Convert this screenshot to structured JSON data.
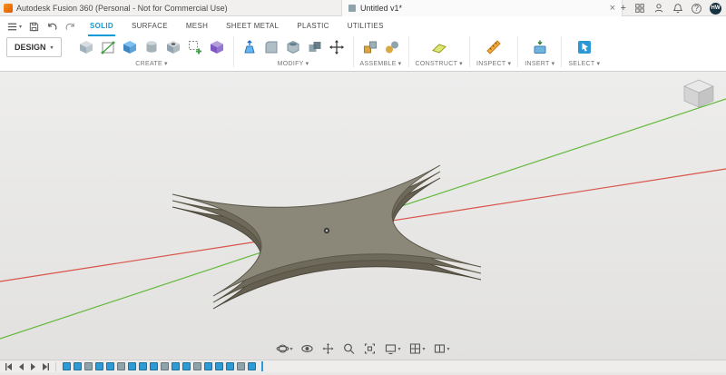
{
  "title_bar": {
    "app_title": "Autodesk Fusion 360 (Personal - Not for Commercial Use)",
    "tab_label": "Untitled v1*",
    "tab_close": "×",
    "new_tab": "+",
    "help": "?",
    "avatar": "HW",
    "right_icons": [
      "new-tab",
      "apps-grid",
      "account",
      "notifications-bell",
      "help",
      "user-avatar"
    ]
  },
  "quick_access": {
    "items": [
      "file-menu",
      "save",
      "undo",
      "redo"
    ],
    "file_menu_caret": "▾"
  },
  "workspace": {
    "label": "DESIGN",
    "caret": "▾"
  },
  "ribbon_tabs": [
    {
      "label": "SOLID",
      "active": true
    },
    {
      "label": "SURFACE",
      "active": false
    },
    {
      "label": "MESH",
      "active": false
    },
    {
      "label": "SHEET METAL",
      "active": false
    },
    {
      "label": "PLASTIC",
      "active": false
    },
    {
      "label": "UTILITIES",
      "active": false
    }
  ],
  "groups": [
    {
      "label": "CREATE",
      "caret": "▾",
      "tools": [
        "new-component",
        "create-sketch",
        "extrude",
        "revolve",
        "hole",
        "pattern",
        "derive"
      ]
    },
    {
      "label": "MODIFY",
      "caret": "▾",
      "tools": [
        "press-pull",
        "fillet",
        "shell",
        "combine",
        "move-copy"
      ]
    },
    {
      "label": "ASSEMBLE",
      "caret": "▾",
      "tools": [
        "insert-component",
        "joint"
      ]
    },
    {
      "label": "CONSTRUCT",
      "caret": "▾",
      "tools": [
        "construction-plane"
      ]
    },
    {
      "label": "INSPECT",
      "caret": "▾",
      "tools": [
        "measure"
      ]
    },
    {
      "label": "INSERT",
      "caret": "▾",
      "tools": [
        "insert"
      ]
    },
    {
      "label": "SELECT",
      "caret": "▾",
      "tools": [
        "select"
      ]
    }
  ],
  "canvas": {
    "model": "shuriken-solid-body",
    "colors": {
      "axis_x": "#d9534a",
      "axis_y": "#63b93c",
      "model_top": "#8c8879",
      "model_side": "#6d695b",
      "model_edge": "#55523f"
    }
  },
  "view_cube": {
    "visible": true
  },
  "nav_bar": {
    "items": [
      "orbit",
      "look-at",
      "pan",
      "zoom",
      "fit",
      "display-settings",
      "grid-display",
      "viewports"
    ]
  },
  "timeline": {
    "playback": [
      "skip-to-start",
      "step-back",
      "play",
      "skip-to-end"
    ],
    "features": [
      {
        "color": "#2e9bd6"
      },
      {
        "color": "#2e9bd6"
      },
      {
        "color": "#8fa3ad"
      },
      {
        "color": "#2e9bd6"
      },
      {
        "color": "#2e9bd6"
      },
      {
        "color": "#8fa3ad"
      },
      {
        "color": "#2e9bd6"
      },
      {
        "color": "#2e9bd6"
      },
      {
        "color": "#2e9bd6"
      },
      {
        "color": "#8fa3ad"
      },
      {
        "color": "#2e9bd6"
      },
      {
        "color": "#2e9bd6"
      },
      {
        "color": "#8fa3ad"
      },
      {
        "color": "#2e9bd6"
      },
      {
        "color": "#2e9bd6"
      },
      {
        "color": "#2e9bd6"
      },
      {
        "color": "#8fa3ad"
      },
      {
        "color": "#2e9bd6"
      }
    ]
  }
}
